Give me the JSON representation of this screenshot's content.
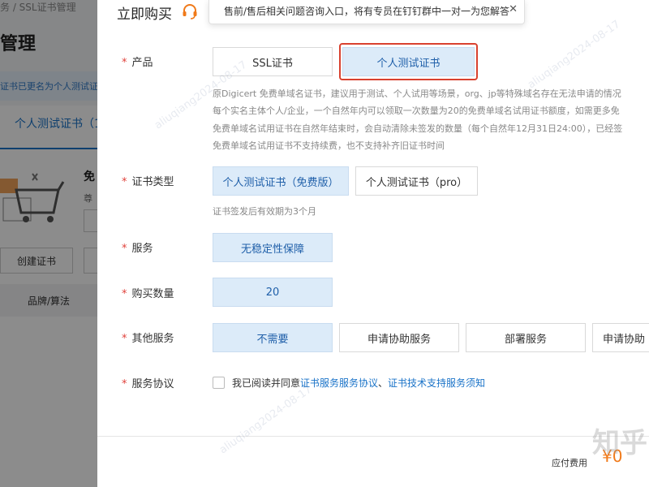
{
  "background": {
    "breadcrumb": "务 / SSL证书管理",
    "page_title": "管理",
    "notice": "证书已更名为个人测试证",
    "tab_label": "个人测试证书（1",
    "side_text": "免",
    "side_sub": "尊",
    "create_button": "创建证书",
    "column_header": "品牌/算法"
  },
  "drawer": {
    "title": "立即购买",
    "tooltip": "售前/售后相关问题咨询入口，将有专员在钉钉群中一对一为您解答",
    "tooltip_close": "✕"
  },
  "product": {
    "label": "产品",
    "options": [
      "SSL证书",
      "个人测试证书"
    ],
    "selected": 1,
    "description": [
      "原Digicert 免费单域名证书，建议用于测试、个人试用等场景，org、jp等特殊域名存在无法申请的情况",
      "每个实名主体个人/企业，一个自然年内可以领取一次数量为20的免费单域名试用证书额度，如需更多免",
      "免费单域名试用证书在自然年结束时，会自动清除未签发的数量（每个自然年12月31日24:00），已经签",
      "免费单域名试用证书不支持续费，也不支持补齐旧证书时间"
    ]
  },
  "cert_type": {
    "label": "证书类型",
    "options": [
      "个人测试证书（免费版）",
      "个人测试证书（pro）"
    ],
    "selected": 0,
    "hint": "证书签发后有效期为3个月"
  },
  "service": {
    "label": "服务",
    "options": [
      "无稳定性保障"
    ],
    "selected": 0
  },
  "quantity": {
    "label": "购买数量",
    "value": "20"
  },
  "other_services": {
    "label": "其他服务",
    "options": [
      "不需要",
      "申请协助服务",
      "部署服务",
      "申请协助"
    ],
    "selected": 0
  },
  "agreement": {
    "label": "服务协议",
    "prefix": "我已阅读并同意",
    "link1": "证书服务服务协议",
    "sep": "、",
    "link2": "证书技术支持服务须知"
  },
  "footer": {
    "fee_label": "应付费用",
    "fee_value": "¥0"
  },
  "watermark_text": "aliuqiang2024-08-17",
  "brand_mark": "知乎",
  "colors": {
    "accent": "#1a73c8",
    "selected_bg": "#dcebf9",
    "required": "#e0413b",
    "highlight": "#d9412f",
    "price": "#f07a1a",
    "headset": "#f07a1a"
  }
}
